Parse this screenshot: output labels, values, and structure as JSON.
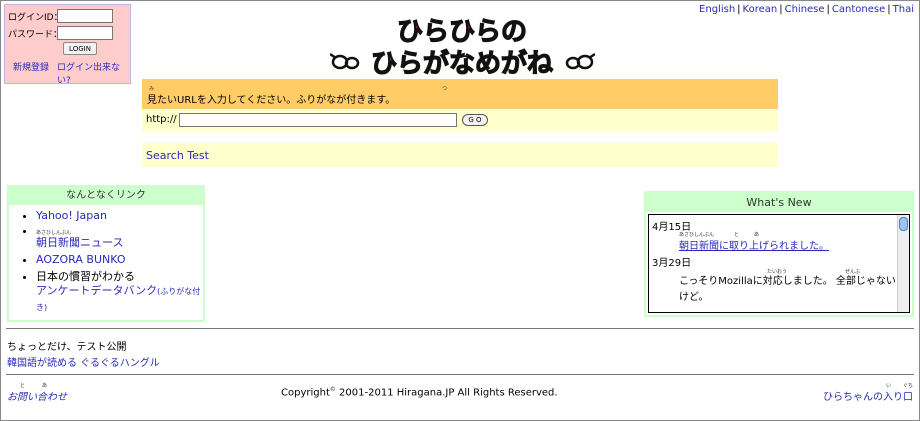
{
  "login": {
    "id_label": "ログインID：",
    "pw_label": "パスワード：",
    "button": "LOGIN",
    "register": "新規登録",
    "forgot": "ログイン出来ない?"
  },
  "languages": [
    "English",
    "Korean",
    "Chinese",
    "Cantonese",
    "Thai"
  ],
  "logo": {
    "line1": "ひらひらの",
    "line2": "ひらがなめがね"
  },
  "url": {
    "prompt": "見たいURLを入力してください。ふりがなが付きます。",
    "ruby1": "み",
    "ruby2": "つ",
    "http": "http://",
    "go": "G O",
    "search_test": "Search Test"
  },
  "links": {
    "header": "なんとなくリンク",
    "items": [
      "Yahoo! Japan",
      "朝日新聞ニュース",
      "AOZORA BUNKO"
    ],
    "item2_ruby": "あさひしんぶん",
    "item4_text": "日本の慣習がわかる",
    "item4_link": "アンケートデータバンク",
    "item4_note": "(ふりがな付き)"
  },
  "news": {
    "header": "What's New",
    "date1": "4月15日",
    "entry1": "朝日新聞に取り上げられました。",
    "entry1_ruby": "あさひしんぶん",
    "entry1_ruby2": "と",
    "entry1_ruby3": "あ",
    "date2": "3月29日",
    "entry2": "こっそりMozillaに対応しました。 全部じゃないけど。",
    "entry2_ruby": "たいおう",
    "entry2_ruby2": "ぜんぶ"
  },
  "footer": {
    "test": "ちょっとだけ、テスト公開",
    "korean": "韓国語が読める ぐるぐるハングル",
    "contact": "お問い合わせ",
    "contact_ruby": "と",
    "contact_ruby2": "あ",
    "copyright_pre": "Copyright",
    "copyright_sym": "©",
    "copyright_post": " 2001-2011 Hiragana.JP All Rights Reserved.",
    "entrance": "ひらちゃんの入り口",
    "entrance_ruby": "い",
    "entrance_ruby2": "ぐち"
  },
  "colors": {
    "link": "#2a2ab8",
    "login_bg": "#ffcccc",
    "url_bg": "#ffcc66",
    "pale": "#ffffcc",
    "green": "#ccffcc"
  }
}
